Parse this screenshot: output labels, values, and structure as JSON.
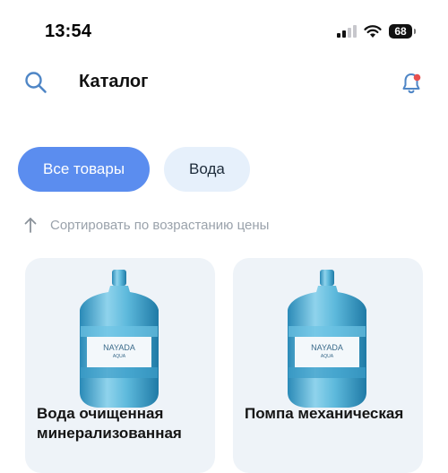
{
  "status_bar": {
    "time": "13:54",
    "battery": "68"
  },
  "header": {
    "title": "Каталог"
  },
  "filters": {
    "all_label": "Все товары",
    "water_label": "Вода"
  },
  "sort": {
    "label": "Сортировать по возрастанию цены"
  },
  "products": [
    {
      "title": "Вода очищенная минерализованная",
      "brand": "NAYADA",
      "sub": "AQUA"
    },
    {
      "title": "Помпа механическая",
      "brand": "NAYADA",
      "sub": "AQUA"
    }
  ],
  "colors": {
    "accent": "#5b8def",
    "chip_inactive": "#e6f0fb",
    "card_bg": "#eef3f8",
    "notification_dot": "#e8504f"
  }
}
